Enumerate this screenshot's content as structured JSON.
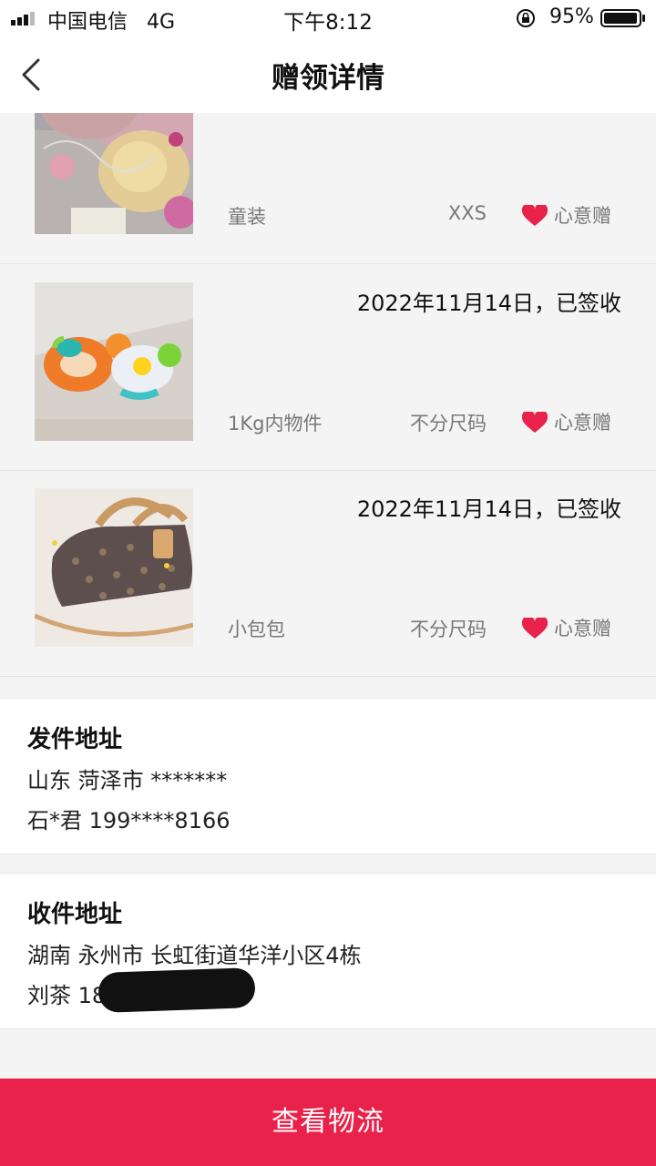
{
  "status_bar": {
    "carrier": "中国电信",
    "network": "4G",
    "time": "下午8:12",
    "battery": "95%"
  },
  "nav": {
    "title": "赠领详情"
  },
  "items": [
    {
      "date": "",
      "name": "童装",
      "size": "XXS",
      "gift_label": "心意赠"
    },
    {
      "date": "2022年11月14日，已签收",
      "name": "1Kg内物件",
      "size": "不分尺码",
      "gift_label": "心意赠"
    },
    {
      "date": "2022年11月14日，已签收",
      "name": "小包包",
      "size": "不分尺码",
      "gift_label": "心意赠"
    }
  ],
  "sender": {
    "heading": "发件地址",
    "address": "山东 菏泽市 *******",
    "contact": "石*君 199****8166"
  },
  "receiver": {
    "heading": "收件地址",
    "address": "湖南 永州市 长虹街道华洋小区4栋",
    "contact": "刘茶 18"
  },
  "action": {
    "logistics_label": "查看物流"
  },
  "colors": {
    "accent": "#e8224a",
    "heart": "#e8224a"
  }
}
